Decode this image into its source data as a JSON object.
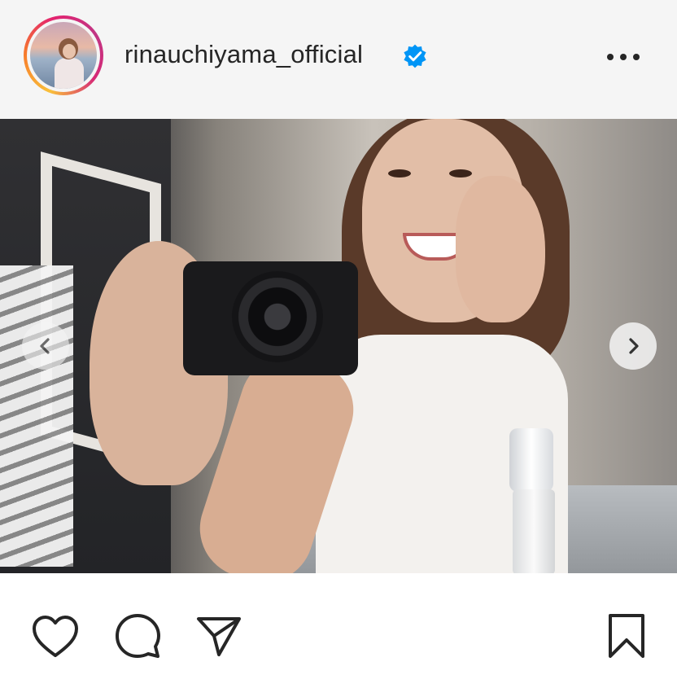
{
  "post": {
    "username": "rinauchiyama_official",
    "verified": true,
    "avatar_icon": "profile-avatar",
    "more_icon": "more-horizontal-icon",
    "image_icon": "post-photo",
    "carousel": {
      "prev_icon": "chevron-left-icon",
      "next_icon": "chevron-right-icon"
    }
  },
  "actions": {
    "icons": [
      "heart-icon",
      "comment-icon",
      "share-icon",
      "bookmark-icon"
    ]
  },
  "colors": {
    "text": "#262626",
    "header_bg": "#f5f5f5",
    "verified_blue": "#0095f6",
    "story_ring": [
      "#f9c03a",
      "#f77b2b",
      "#e3226f",
      "#c13584"
    ]
  }
}
